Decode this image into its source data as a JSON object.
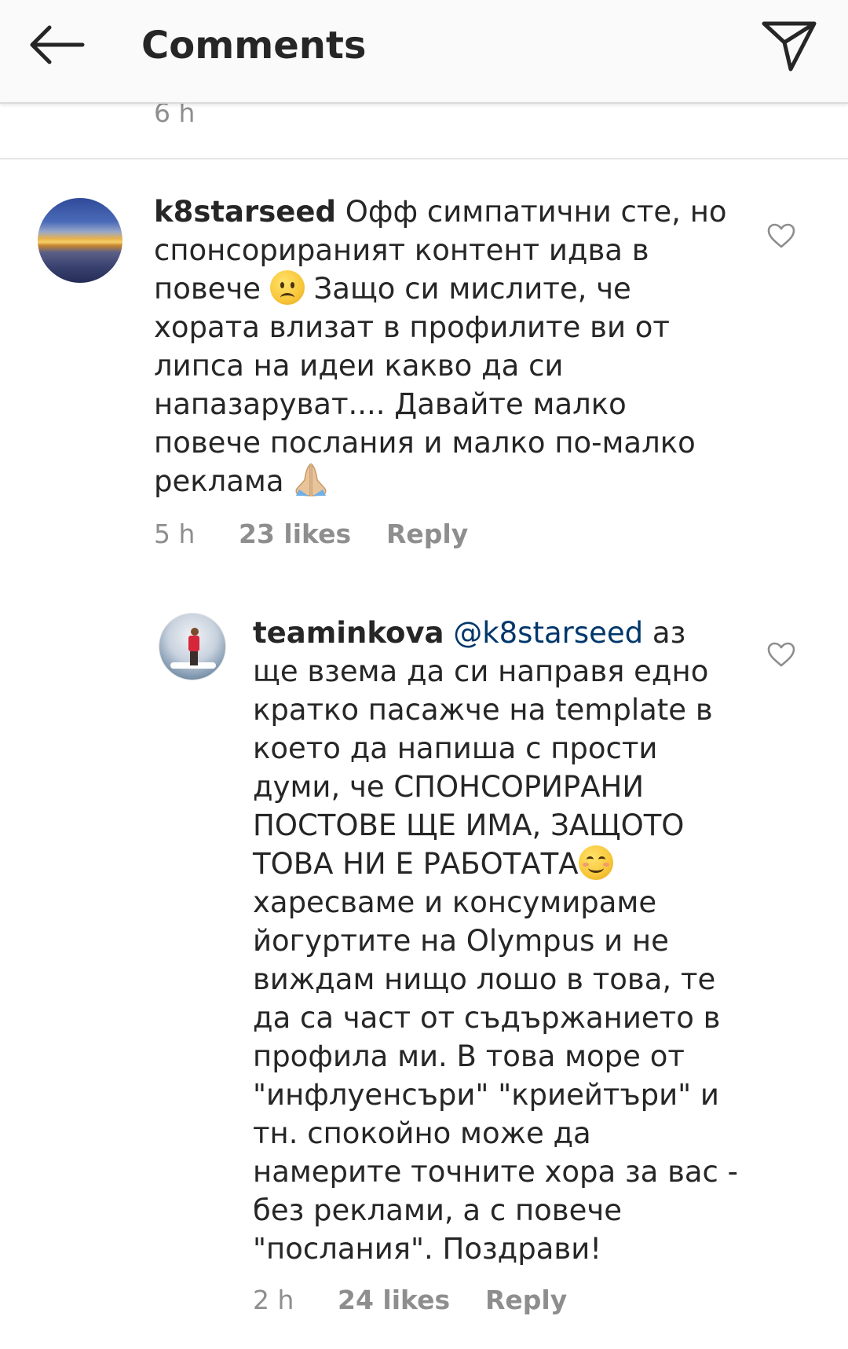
{
  "header": {
    "title": "Comments",
    "back_icon": "arrow-left-icon",
    "send_icon": "paper-plane-icon"
  },
  "previous_comment": {
    "time": "6 h"
  },
  "comments": [
    {
      "username": "k8starseed",
      "segments": [
        " Офф симпатични сте, но спонсорираният контент идва в повече ",
        " Защо си мислите, че хората влизат в профилите ви от липса на идеи какво да си напазаруват.... Давайте малко повече послания и малко по-малко реклама "
      ],
      "emojis": [
        "slightly-frowning-face",
        "folded-hands"
      ],
      "time": "5 h",
      "likes": "23 likes",
      "reply": "Reply"
    },
    {
      "username": "teaminkova",
      "mention": "@k8starseed",
      "segments": [
        " аз ще взема да си направя едно кратко пасажче на template в което да напиша с прости думи, че СПОНСОРИРАНИ ПОСТОВЕ ЩЕ ИМА, ЗАЩОТО ТОВА НИ Е РАБОТАТА",
        " харесваме и консумираме йогуртите на Olympus и не виждам нищо лошо в това, те да са част от съдържанието в профила ми. В това море от \"инфлуенсъри\" \"криейтъри\" и тн. спокойно може да намерите точните хора за вас - без реклами, а с повече \"послания\". Поздрави!"
      ],
      "emojis": [
        "smiling-face-with-smiling-eyes"
      ],
      "time": "2 h",
      "likes": "24 likes",
      "reply": "Reply"
    }
  ],
  "colors": {
    "text": "#262626",
    "muted": "#8e8e8e",
    "mention": "#00376b",
    "header_bg": "#fafafa"
  }
}
